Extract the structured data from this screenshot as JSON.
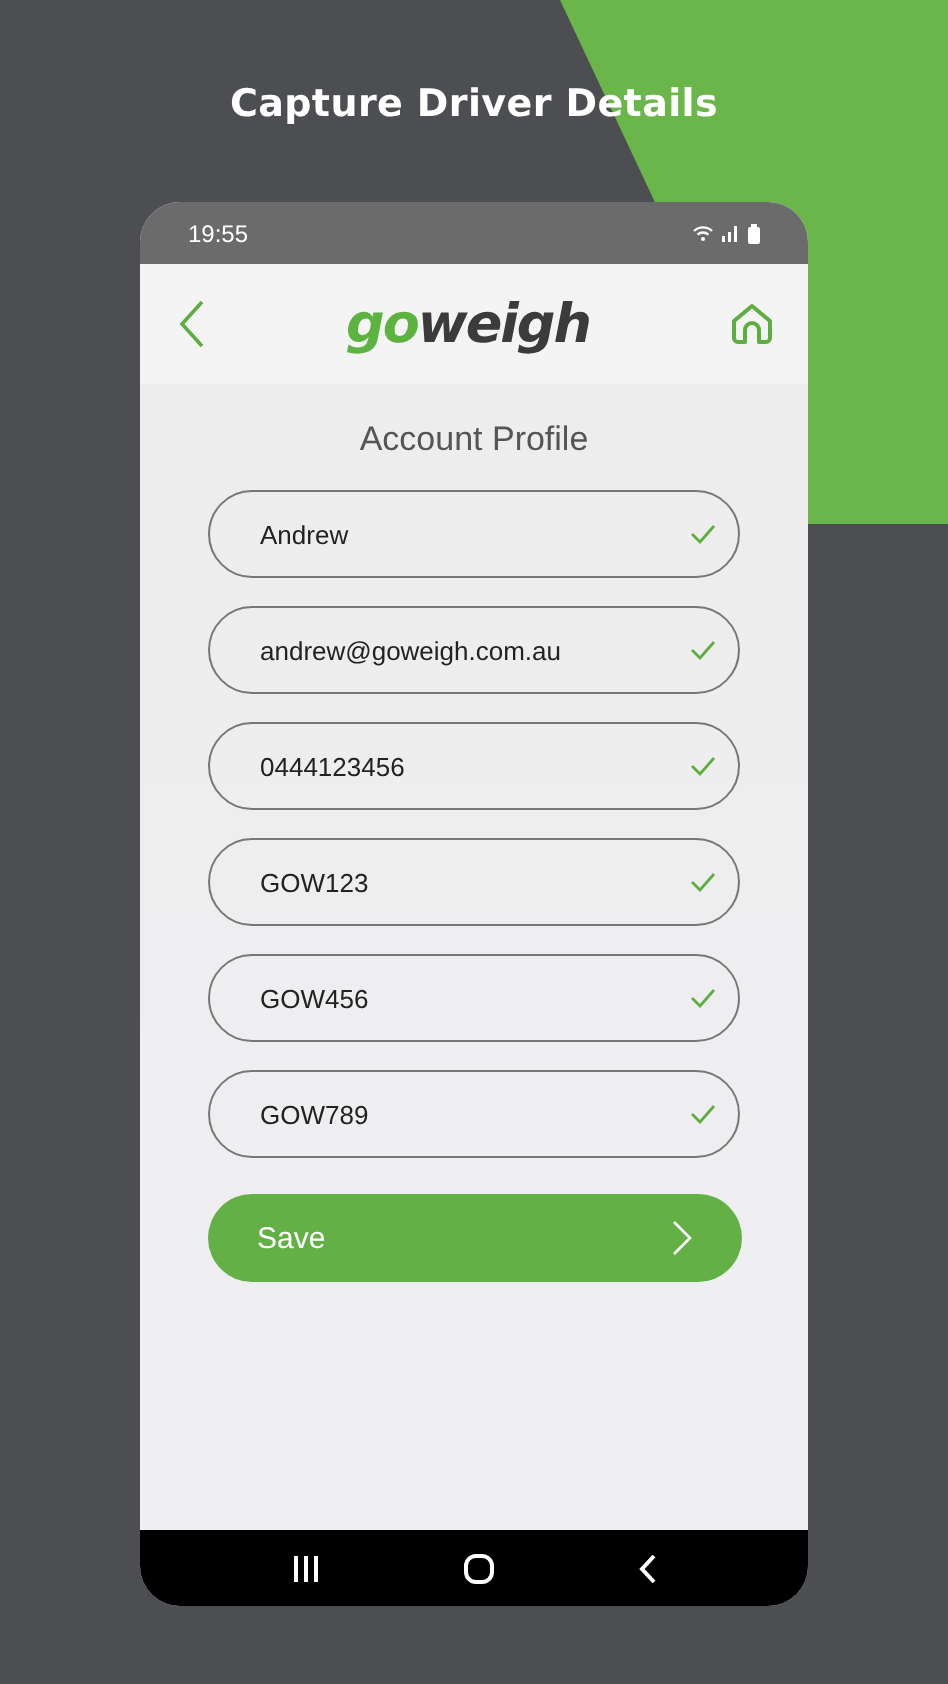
{
  "headline": "Capture Driver Details",
  "status_bar": {
    "time": "19:55"
  },
  "header": {
    "logo": {
      "accent": "go",
      "rest": "weigh"
    }
  },
  "page_title": "Account Profile",
  "fields": [
    {
      "value": "Andrew",
      "valid": true
    },
    {
      "value": "andrew@goweigh.com.au",
      "valid": true
    },
    {
      "value": "0444123456",
      "valid": true
    },
    {
      "value": "GOW123",
      "valid": true
    },
    {
      "value": "GOW456",
      "valid": true
    },
    {
      "value": "GOW789",
      "valid": true
    }
  ],
  "save_button": {
    "label": "Save"
  }
}
